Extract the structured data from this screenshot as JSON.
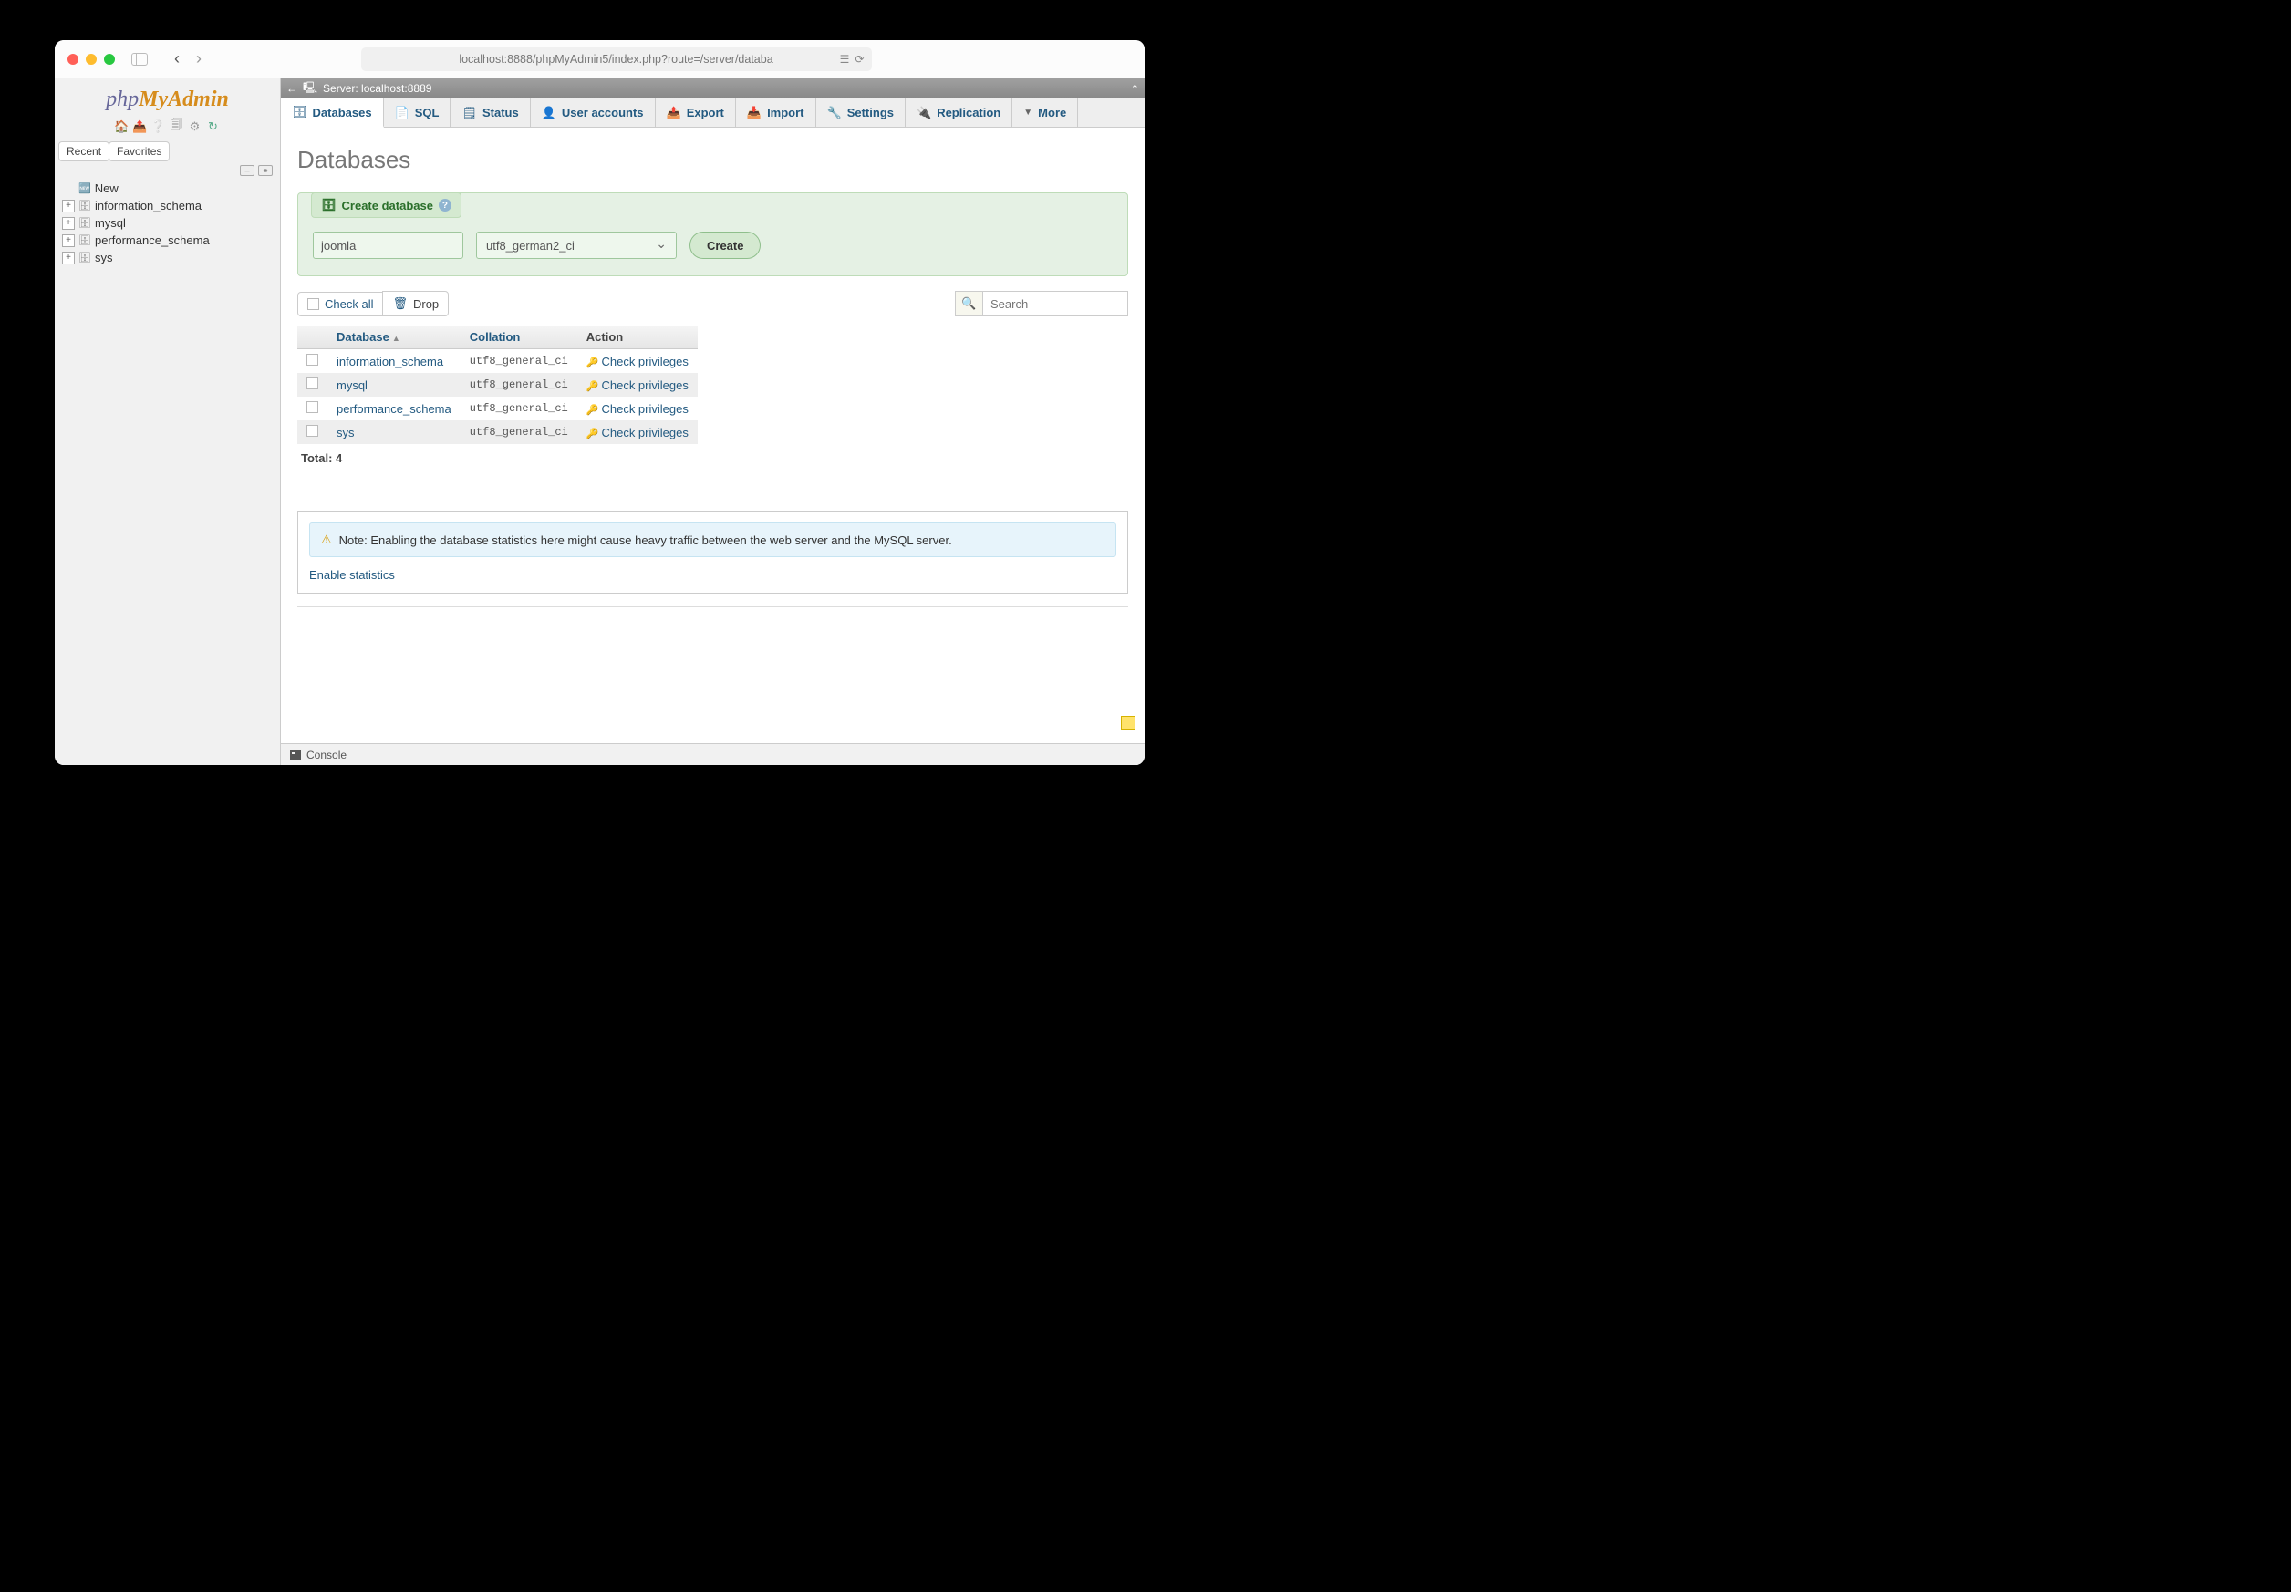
{
  "browser": {
    "url": "localhost:8888/phpMyAdmin5/index.php?route=/server/databa"
  },
  "logo": {
    "part1": "php",
    "part2": "MyAdmin"
  },
  "sidebar": {
    "tabs": {
      "recent": "Recent",
      "favorites": "Favorites"
    },
    "new_label": "New",
    "items": [
      "information_schema",
      "mysql",
      "performance_schema",
      "sys"
    ]
  },
  "serverbar": {
    "label": "Server: localhost:8889"
  },
  "toptabs": {
    "databases": "Databases",
    "sql": "SQL",
    "status": "Status",
    "users": "User accounts",
    "export": "Export",
    "import": "Import",
    "settings": "Settings",
    "replication": "Replication",
    "more": "More"
  },
  "page": {
    "title": "Databases",
    "create": {
      "legend": "Create database",
      "name_value": "joomla",
      "collation_value": "utf8_german2_ci",
      "button": "Create"
    },
    "toolbar": {
      "checkall": "Check all",
      "drop": "Drop",
      "search_placeholder": "Search"
    },
    "table": {
      "col_db": "Database",
      "col_coll": "Collation",
      "col_action": "Action",
      "action_label": "Check privileges",
      "rows": [
        {
          "name": "information_schema",
          "collation": "utf8_general_ci"
        },
        {
          "name": "mysql",
          "collation": "utf8_general_ci"
        },
        {
          "name": "performance_schema",
          "collation": "utf8_general_ci"
        },
        {
          "name": "sys",
          "collation": "utf8_general_ci"
        }
      ],
      "total": "Total: 4"
    },
    "note": {
      "text": "Note: Enabling the database statistics here might cause heavy traffic between the web server and the MySQL server.",
      "link": "Enable statistics"
    },
    "console": "Console"
  }
}
